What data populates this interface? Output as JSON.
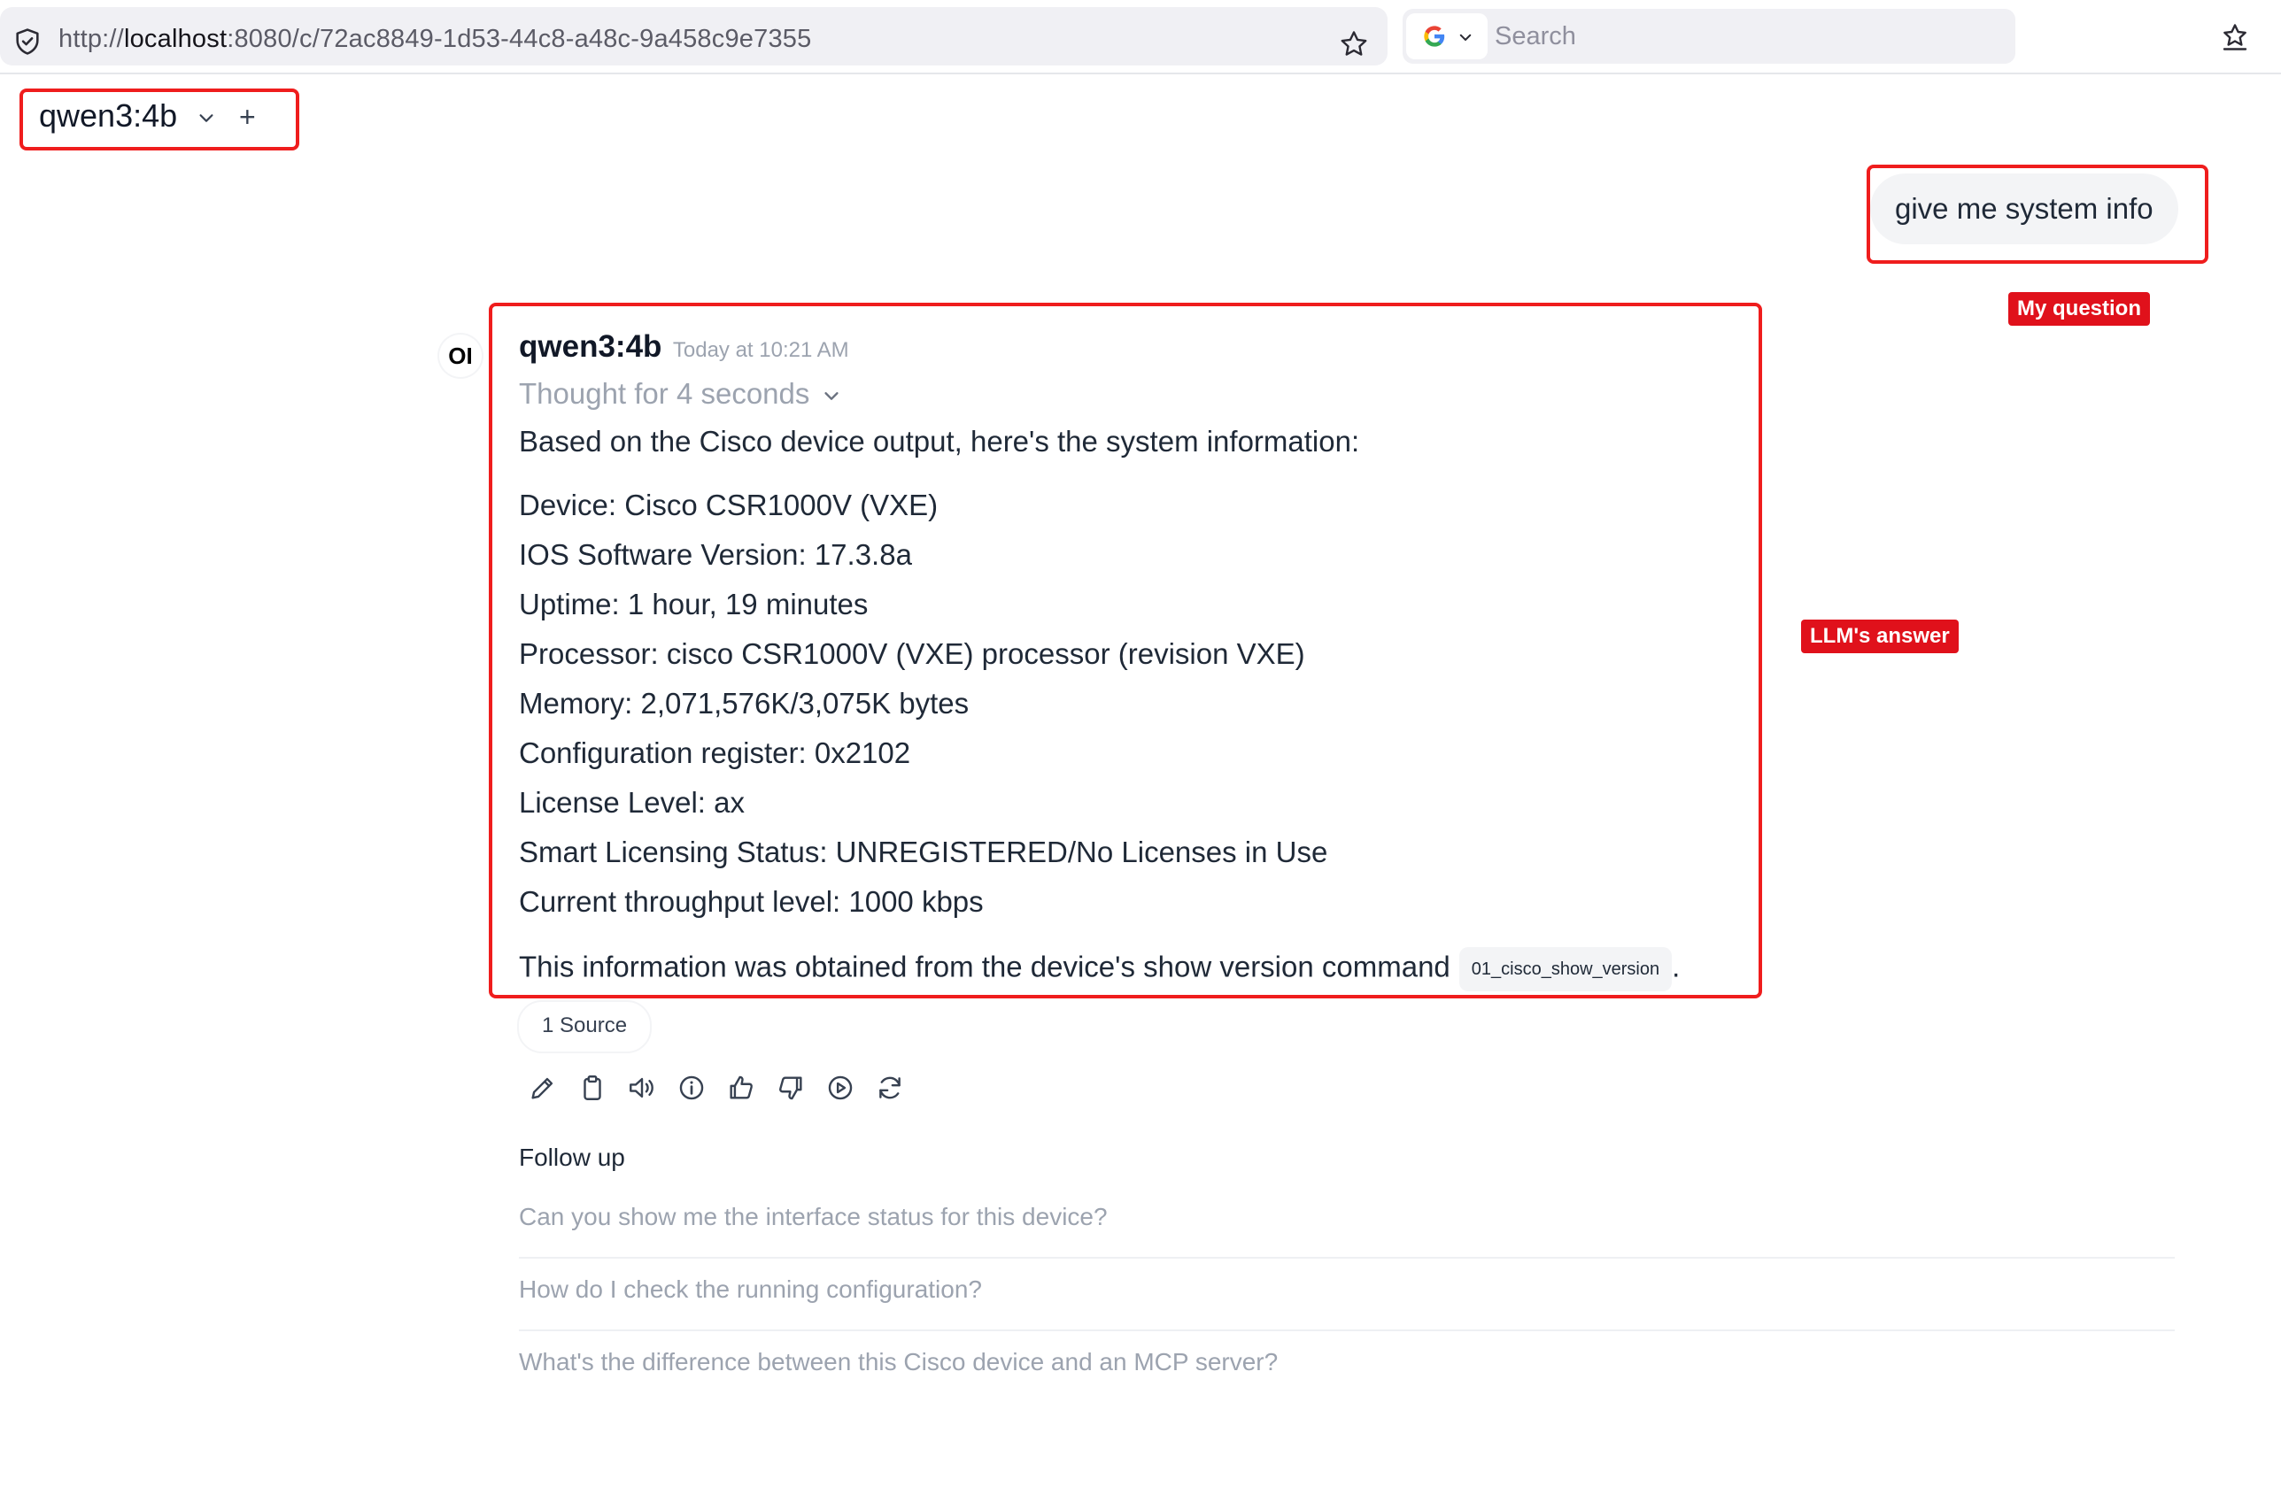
{
  "browser": {
    "url_prefix": "http://",
    "url_host": "localhost",
    "url_rest": ":8080/c/72ac8849-1d53-44c8-a48c-9a458c9e7355",
    "search_placeholder": "Search"
  },
  "header": {
    "model_name": "qwen3:4b",
    "add_label": "+"
  },
  "annotations": {
    "question_label": "My question",
    "answer_label": "LLM's answer",
    "color": "#e0111b"
  },
  "user_message": {
    "text": "give me system info"
  },
  "assistant": {
    "avatar": "OI",
    "model": "qwen3:4b",
    "time": "Today at 10:21 AM",
    "thought": "Thought for 4 seconds",
    "intro": "Based on the Cisco device output, here's the system information:",
    "lines": [
      "Device: Cisco CSR1000V (VXE)",
      "IOS Software Version: 17.3.8a",
      "Uptime: 1 hour, 19 minutes",
      "Processor: cisco CSR1000V (VXE) processor (revision VXE)",
      "Memory: 2,071,576K/3,075K bytes",
      "Configuration register: 0x2102",
      "License Level: ax",
      "Smart Licensing Status: UNREGISTERED/No Licenses in Use",
      "Current throughput level: 1000 kbps"
    ],
    "closing": "This information was obtained from the device's show version command",
    "citation": "01_cisco_show_version",
    "closing_punct": ".",
    "sources": "1 Source",
    "actions": [
      "edit-icon",
      "copy-icon",
      "read-aloud-icon",
      "info-icon",
      "thumbs-up-icon",
      "thumbs-down-icon",
      "play-icon",
      "regenerate-icon"
    ]
  },
  "followup": {
    "title": "Follow up",
    "items": [
      "Can you show me the interface status for this device?",
      "How do I check the running configuration?",
      "What's the difference between this Cisco device and an MCP server?"
    ]
  }
}
